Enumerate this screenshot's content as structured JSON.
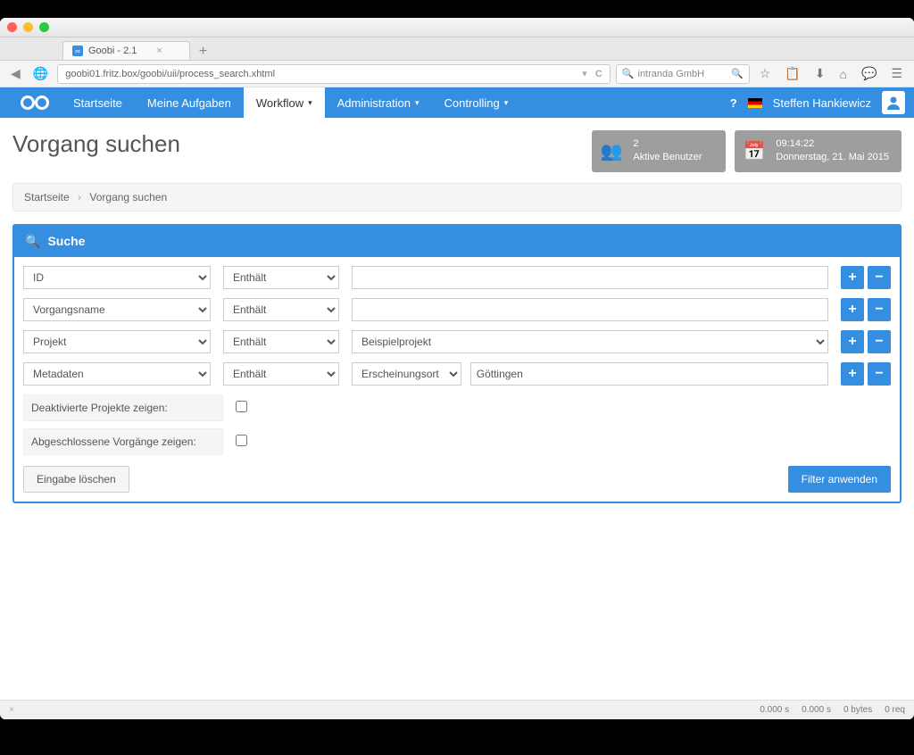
{
  "browser": {
    "tab_title": "Goobi - 2.1",
    "url": "goobi01.fritz.box/goobi/uii/process_search.xhtml",
    "search_placeholder": "intranda GmbH"
  },
  "nav": {
    "items": [
      "Startseite",
      "Meine Aufgaben",
      "Workflow",
      "Administration",
      "Controlling"
    ],
    "active_index": 2,
    "username": "Steffen Hankiewicz"
  },
  "page": {
    "title": "Vorgang suchen",
    "stat_users": {
      "count": "2",
      "label": "Aktive Benutzer"
    },
    "stat_time": {
      "time": "09:14:22",
      "date": "Donnerstag, 21. Mai 2015"
    },
    "breadcrumb": [
      "Startseite",
      "Vorgang suchen"
    ]
  },
  "panel": {
    "title": "Suche",
    "rows": [
      {
        "field": "ID",
        "op": "Enthält",
        "value": "",
        "sub": ""
      },
      {
        "field": "Vorgangsname",
        "op": "Enthält",
        "value": "",
        "sub": ""
      },
      {
        "field": "Projekt",
        "op": "Enthält",
        "value": "Beispielprojekt",
        "sub": ""
      },
      {
        "field": "Metadaten",
        "op": "Enthält",
        "value": "Göttingen",
        "sub": "Erscheinungsort"
      }
    ],
    "option_deactivated": "Deaktivierte Projekte zeigen:",
    "option_closed": "Abgeschlossene Vorgänge zeigen:",
    "btn_clear": "Eingabe löschen",
    "btn_apply": "Filter anwenden"
  },
  "status": {
    "t1": "0.000 s",
    "t2": "0.000 s",
    "bytes": "0 bytes",
    "req": "0 req"
  }
}
